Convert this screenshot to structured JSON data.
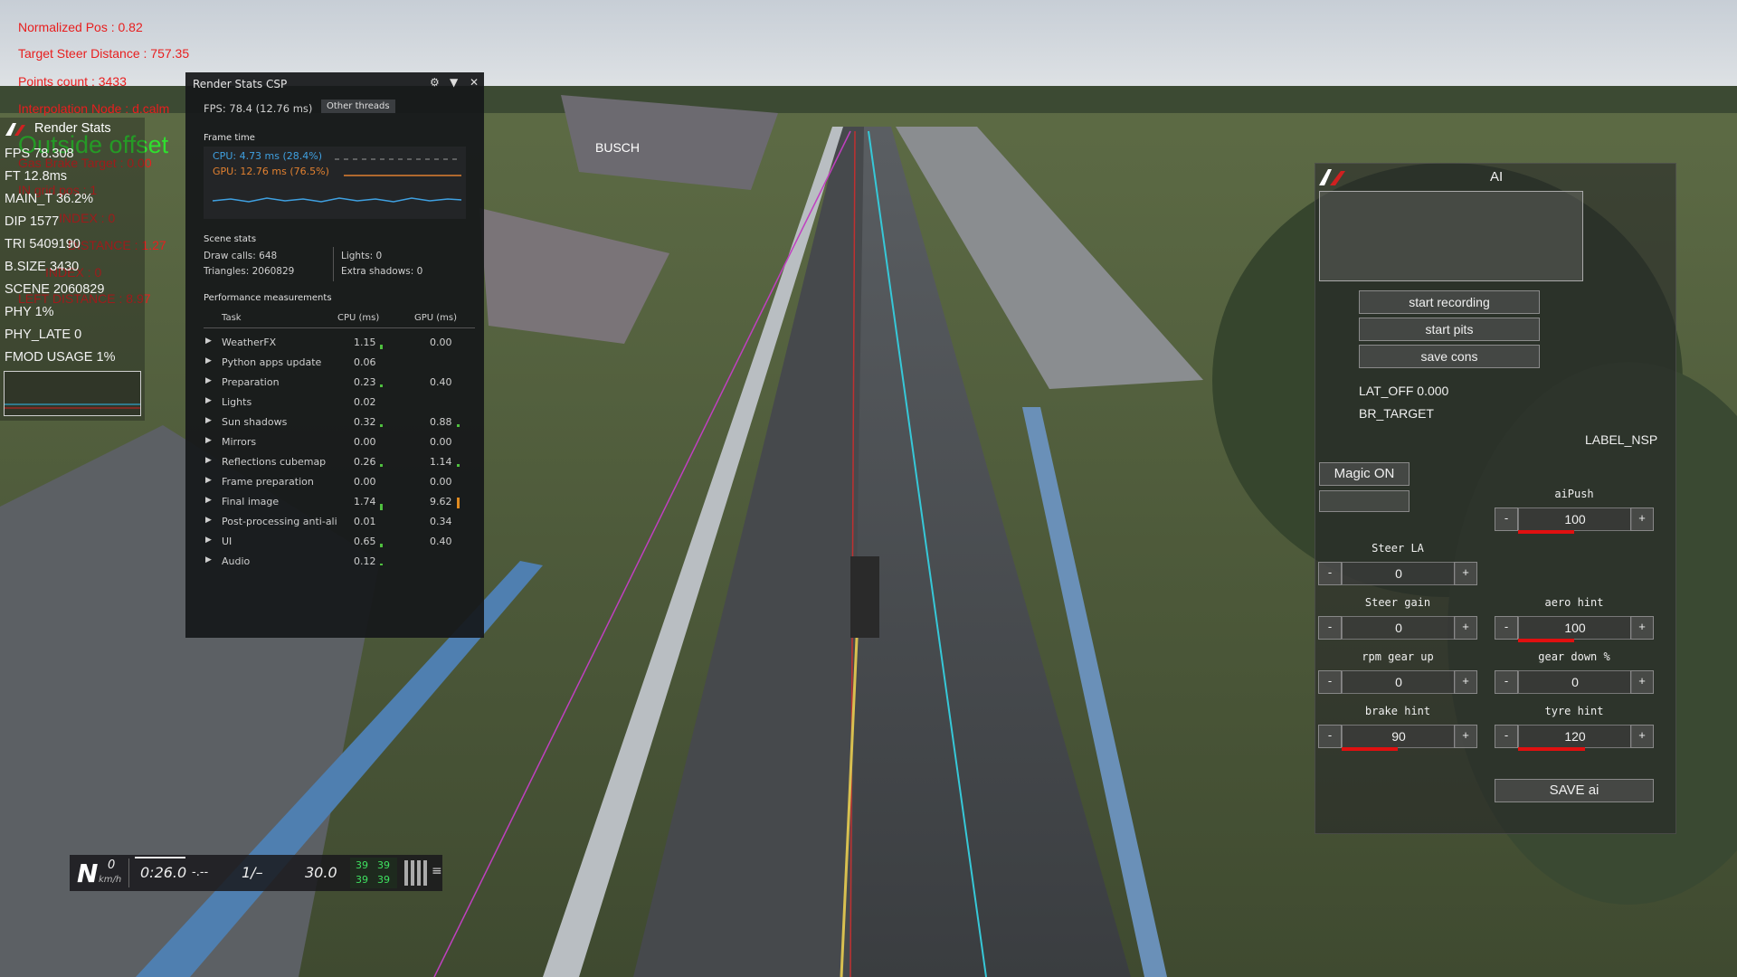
{
  "debug_overlay": {
    "normalized_pos": "Normalized Pos : 0.82",
    "target_steer_distance": "Target Steer Distance : 757.35",
    "points_count": "Points count : 3433",
    "interpolation": "Interpolation Node : d.calm",
    "gas_brake_target": "Gas Brake Target : 0.00",
    "in_grid": "IN grid pos : 1",
    "index": "INDEX : 0",
    "distance": "DISTANCE : 1.27",
    "index2": "INDEX : 0",
    "left_distance": "LEFT DISTANCE : 8.97",
    "outside_offset": "Outside offset"
  },
  "render_stats": {
    "title": "Render Stats",
    "lines": [
      "FPS 78.308",
      "FT 12.8ms",
      "MAIN_T 36.2%",
      "DIP 1577",
      "TRI 5409190",
      "B.SIZE 3430",
      "SCENE 2060829",
      "PHY 1%",
      "PHY_LATE 0",
      "FMOD USAGE 1%"
    ]
  },
  "csp": {
    "title": "Render Stats CSP",
    "fps": "FPS: 78.4 (12.76 ms)",
    "other_threads": "Other threads",
    "frame_time_label": "Frame time",
    "cpu_line": "CPU: 4.73 ms (28.4%)",
    "gpu_line": "GPU: 12.76 ms (76.5%)",
    "scene_stats_label": "Scene stats",
    "draw_calls": "Draw calls: 648",
    "lights": "Lights: 0",
    "triangles": "Triangles: 2060829",
    "extra_shadows": "Extra shadows: 0",
    "perf_label": "Performance measurements",
    "col_task": "Task",
    "col_cpu": "CPU (ms)",
    "col_gpu": "GPU (ms)",
    "rows": [
      {
        "name": "WeatherFX",
        "cpu": "1.15",
        "gpu": "0.00"
      },
      {
        "name": "Python apps update",
        "cpu": "0.06",
        "gpu": ""
      },
      {
        "name": "Preparation",
        "cpu": "0.23",
        "gpu": "0.40"
      },
      {
        "name": "Lights",
        "cpu": "0.02",
        "gpu": ""
      },
      {
        "name": "Sun shadows",
        "cpu": "0.32",
        "gpu": "0.88"
      },
      {
        "name": "Mirrors",
        "cpu": "0.00",
        "gpu": "0.00"
      },
      {
        "name": "Reflections cubemap",
        "cpu": "0.26",
        "gpu": "1.14"
      },
      {
        "name": "Frame preparation",
        "cpu": "0.00",
        "gpu": "0.00"
      },
      {
        "name": "Final image",
        "cpu": "1.74",
        "gpu": "9.62"
      },
      {
        "name": "Post-processing anti-ali",
        "cpu": "0.01",
        "gpu": "0.34"
      },
      {
        "name": "UI",
        "cpu": "0.65",
        "gpu": "0.40"
      },
      {
        "name": "Audio",
        "cpu": "0.12",
        "gpu": ""
      }
    ],
    "colors": {
      "cpu": "#3fa0e0",
      "gpu": "#e08030",
      "bar_green": "#4fbf3f",
      "bar_orange": "#e08a20"
    }
  },
  "hud": {
    "gear": "N",
    "speed": "0",
    "speed_unit": "km/h",
    "time": "0:26.0",
    "delta": "-.--",
    "position": "1/–",
    "fuel": "30.0",
    "tyre_temps": [
      "39",
      "39",
      "39",
      "39"
    ]
  },
  "ai": {
    "title": "AI",
    "start_recording": "start recording",
    "start_pits": "start pits",
    "save_cons": "save cons",
    "lat_off": "LAT_OFF 0.000",
    "br_target": "BR_TARGET",
    "label_nsp": "LABEL_NSP",
    "magic_on": "Magic ON",
    "save_ai": "SAVE ai",
    "steppers": {
      "ai_push": {
        "label": "aiPush",
        "value": "100",
        "level": 0.5
      },
      "steer_la": {
        "label": "Steer LA",
        "value": "0",
        "level": 0
      },
      "steer_gain": {
        "label": "Steer gain",
        "value": "0",
        "level": 0
      },
      "aero_hint": {
        "label": "aero hint",
        "value": "100",
        "level": 0.5
      },
      "rpm_gear_up": {
        "label": "rpm gear up",
        "value": "0",
        "level": 0
      },
      "gear_down": {
        "label": "gear down %",
        "value": "0",
        "level": 0
      },
      "brake_hint": {
        "label": "brake hint",
        "value": "90",
        "level": 0.5
      },
      "tyre_hint": {
        "label": "tyre hint",
        "value": "120",
        "level": 0.6
      }
    },
    "minus": "-",
    "plus": "+"
  },
  "scene": {
    "banner_text": "BUSCH"
  }
}
